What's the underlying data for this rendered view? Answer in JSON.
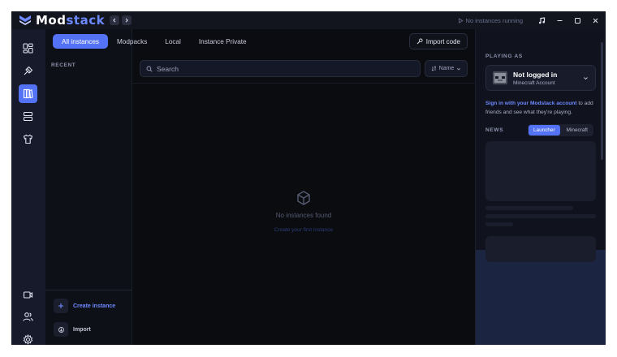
{
  "app": {
    "name_prefix": "Mod",
    "name_suffix": "stack",
    "run_status": "No instances running"
  },
  "tabs": [
    {
      "label": "All instances",
      "active": true
    },
    {
      "label": "Modpacks",
      "active": false
    },
    {
      "label": "Local",
      "active": false
    },
    {
      "label": "Instance Private",
      "active": false
    }
  ],
  "toolbar": {
    "import_code_label": "Import code",
    "search_placeholder": "Search",
    "sort_label": "Name"
  },
  "sidebar": {
    "recent_label": "RECENT",
    "create_label": "Create instance",
    "import_label": "Import"
  },
  "empty_state": {
    "title": "No instances found",
    "link": "Create your first instance"
  },
  "right_panel": {
    "playing_as_label": "PLAYING AS",
    "account_name": "Not logged in",
    "account_type": "Minecraft Account",
    "signin_link": "Sign in with your Modstack account",
    "signin_rest": " to add friends and see what they're playing.",
    "news_label": "NEWS",
    "news_tabs": [
      {
        "label": "Launcher",
        "active": true
      },
      {
        "label": "Minecraft",
        "active": false
      }
    ]
  },
  "colors": {
    "accent": "#5472f5",
    "accent_text": "#6d89ff",
    "background": "#0b0c11"
  }
}
